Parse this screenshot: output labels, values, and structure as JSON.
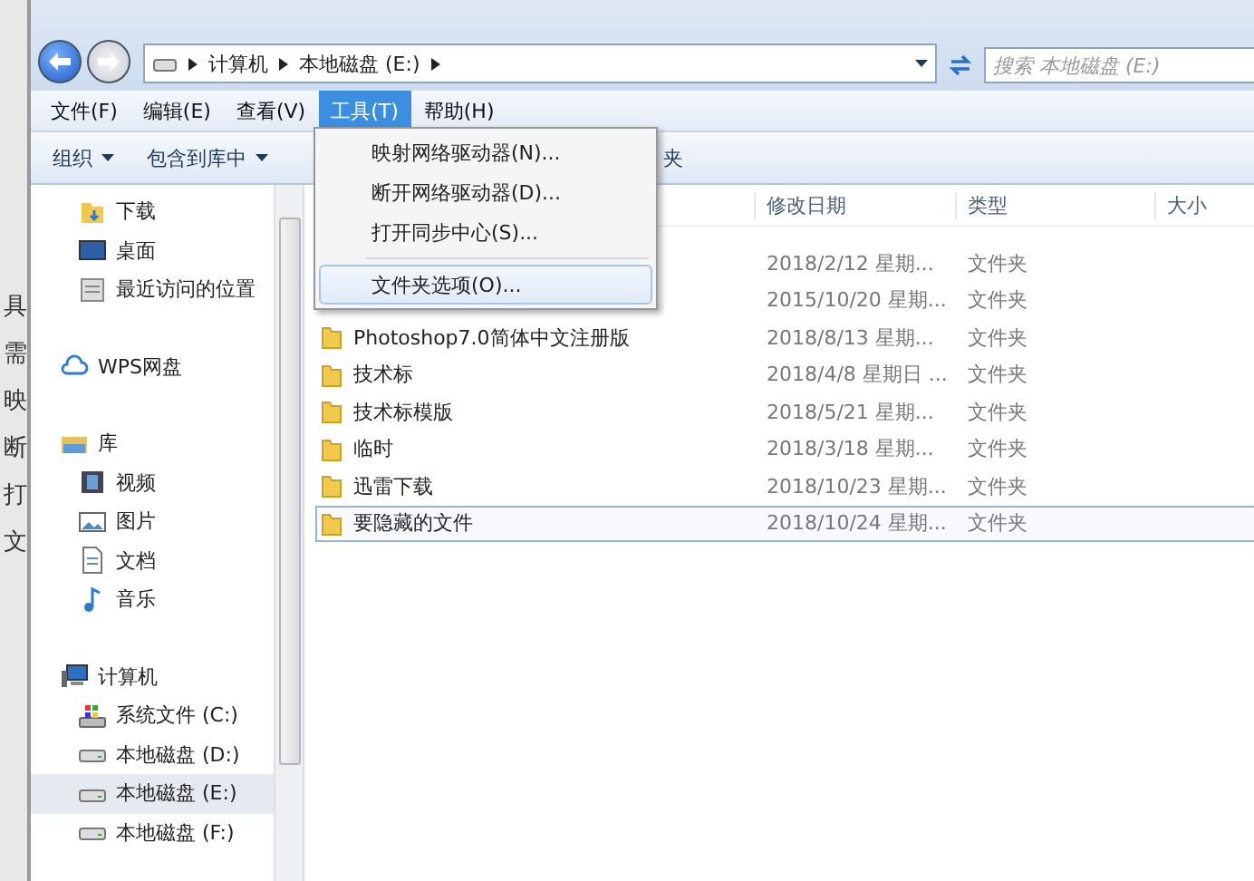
{
  "background_window": {
    "texts": [
      "具",
      "需",
      "映",
      "断",
      "打",
      "文"
    ]
  },
  "address_bar": {
    "crumbs": [
      "计算机",
      "本地磁盘 (E:)"
    ]
  },
  "search": {
    "placeholder": "搜索 本地磁盘 (E:)"
  },
  "menu_bar": [
    {
      "label": "文件(F)",
      "selected": false
    },
    {
      "label": "编辑(E)",
      "selected": false
    },
    {
      "label": "查看(V)",
      "selected": false
    },
    {
      "label": "工具(T)",
      "selected": true
    },
    {
      "label": "帮助(H)",
      "selected": false
    }
  ],
  "menu": {
    "items": [
      {
        "label": "映射网络驱动器(N)...",
        "selected": false
      },
      {
        "label": "断开网络驱动器(D)...",
        "selected": false
      },
      {
        "label": "打开同步中心(S)...",
        "selected": false
      },
      {
        "kind": "separator"
      },
      {
        "label": "文件夹选项(O)...",
        "selected": true
      }
    ]
  },
  "toolbar": [
    {
      "label": "组织",
      "dropdown": true
    },
    {
      "label": "包含到库中",
      "dropdown": true
    },
    {
      "label": "夹",
      "dropdown": false
    }
  ],
  "nav": [
    {
      "children": [
        {
          "label": "下载",
          "kind": "download",
          "selected": false
        },
        {
          "label": "桌面",
          "kind": "desktop",
          "selected": false
        },
        {
          "label": "最近访问的位置",
          "kind": "recent",
          "selected": false
        }
      ]
    },
    {
      "label": "WPS网盘",
      "kind": "cloud",
      "selected": false
    },
    {
      "label": "库",
      "kind": "library",
      "selected": false,
      "children": [
        {
          "label": "视频",
          "kind": "video",
          "selected": false
        },
        {
          "label": "图片",
          "kind": "picture",
          "selected": false
        },
        {
          "label": "文档",
          "kind": "document",
          "selected": false
        },
        {
          "label": "音乐",
          "kind": "music",
          "selected": false
        }
      ]
    },
    {
      "label": "计算机",
      "kind": "computer",
      "selected": false,
      "children": [
        {
          "label": "系统文件 (C:)",
          "kind": "system",
          "selected": false
        },
        {
          "label": "本地磁盘 (D:)",
          "kind": "drive",
          "selected": false
        },
        {
          "label": "本地磁盘 (E:)",
          "kind": "drive",
          "selected": true
        },
        {
          "label": "本地磁盘 (F:)",
          "kind": "drive",
          "selected": false
        }
      ]
    }
  ],
  "table": {
    "columns": [
      "修改日期",
      "类型",
      "大小"
    ],
    "rows": [
      {
        "date": "2018/2/12 星期...",
        "type": "文件夹",
        "selected": false
      },
      {
        "date": "2015/10/20 星期...",
        "type": "文件夹",
        "selected": false
      },
      {
        "name": "Photoshop7.0简体中文注册版",
        "date": "2018/8/13 星期...",
        "type": "文件夹",
        "selected": false
      },
      {
        "name": "技术标",
        "date": "2018/4/8 星期日 ...",
        "type": "文件夹",
        "selected": false
      },
      {
        "name": "技术标模版",
        "date": "2018/5/21 星期...",
        "type": "文件夹",
        "selected": false
      },
      {
        "name": "临时",
        "date": "2018/3/18 星期...",
        "type": "文件夹",
        "selected": false
      },
      {
        "name": "迅雷下载",
        "date": "2018/10/23 星期...",
        "type": "文件夹",
        "selected": false
      },
      {
        "name": "要隐藏的文件",
        "date": "2018/10/24 星期...",
        "type": "文件夹",
        "selected": true
      }
    ]
  }
}
